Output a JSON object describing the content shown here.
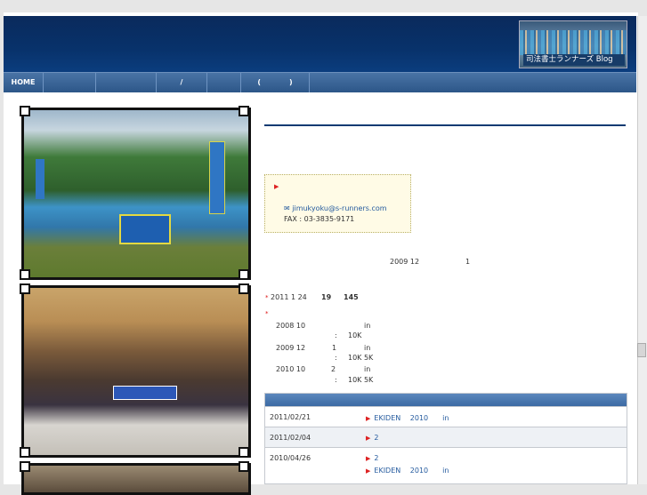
{
  "header": {
    "blog_label": "司法書士ランナーズ Blog"
  },
  "nav": {
    "items": [
      {
        "label": "HOME"
      },
      {
        "label": ""
      },
      {
        "label": ""
      },
      {
        "label": "/"
      },
      {
        "label": ""
      },
      {
        "label": "(　　　　)"
      }
    ]
  },
  "contact": {
    "email": "jimukyoku@s-runners.com",
    "fax": "FAX : 03-3835-9171"
  },
  "intro": {
    "date": "2009 12",
    "count": "1"
  },
  "news": {
    "item1": {
      "prefix": "2011 1 24",
      "n1": "19",
      "n2": "145"
    },
    "records": [
      {
        "date": "2008 10",
        "suffix": "in",
        "detail_sep": ":",
        "detail": "10K"
      },
      {
        "date": "2009 12",
        "num": "1",
        "suffix": "in",
        "detail_sep": ":",
        "detail": "10K 5K"
      },
      {
        "date": "2010 10",
        "num": "2",
        "suffix": "in",
        "detail_sep": ":",
        "detail": "10K 5K"
      }
    ]
  },
  "updates": {
    "rows": [
      {
        "date": "2011/02/21",
        "entries": [
          {
            "text": "EKIDEN　 2010　　in"
          }
        ]
      },
      {
        "date": "2011/02/04",
        "entries": [
          {
            "text": "2"
          }
        ]
      },
      {
        "date": "2010/04/26",
        "entries": [
          {
            "text": "2"
          },
          {
            "text": "EKIDEN　 2010　　in"
          }
        ]
      }
    ]
  }
}
